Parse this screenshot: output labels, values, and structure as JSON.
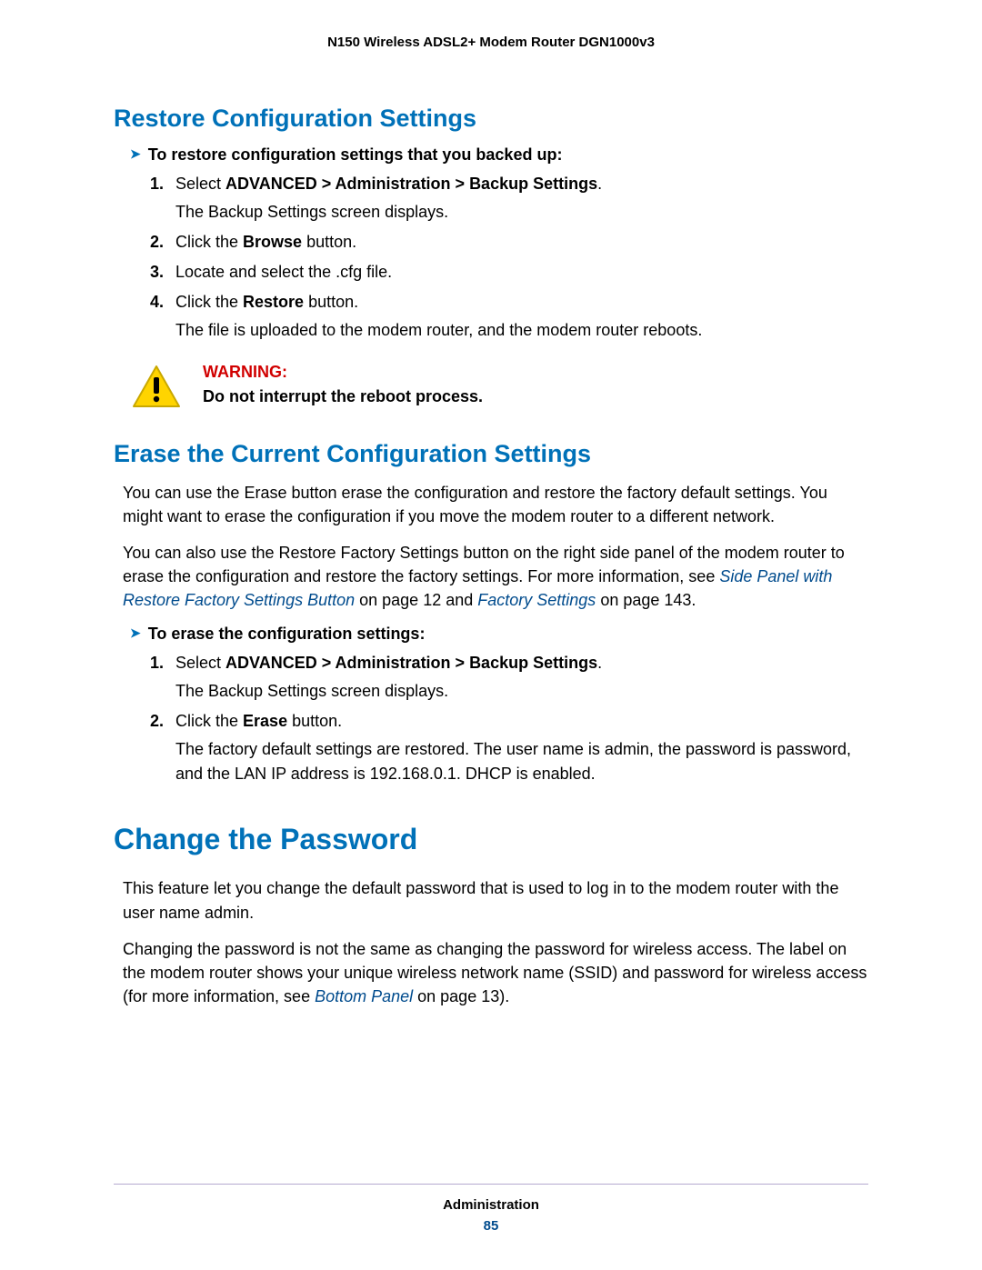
{
  "header": {
    "title": "N150 Wireless ADSL2+ Modem Router DGN1000v3"
  },
  "section1": {
    "title": "Restore Configuration Settings",
    "task": "To restore configuration settings that you backed up:",
    "step1_num": "1.",
    "step1_prefix": "Select ",
    "step1_bold": "ADVANCED > Administration > Backup Settings",
    "step1_suffix": ".",
    "step1_sub": "The Backup Settings screen displays.",
    "step2_num": "2.",
    "step2_a": "Click the ",
    "step2_b": "Browse",
    "step2_c": " button.",
    "step3_num": "3.",
    "step3": "Locate and select the .cfg file.",
    "step4_num": "4.",
    "step4_a": "Click the ",
    "step4_b": "Restore",
    "step4_c": " button.",
    "step4_sub": "The file is uploaded to the modem router, and the modem router reboots."
  },
  "warning": {
    "label": "WARNING:",
    "body": "Do not interrupt the reboot process."
  },
  "section2": {
    "title": "Erase the Current Configuration Settings",
    "para1": "You can use the Erase button erase the configuration and restore the factory default settings. You might want to erase the configuration if you move the modem router to a different network.",
    "para2_a": "You can also use the Restore Factory Settings button on the right side panel of the modem router to erase the configuration and restore the factory settings. For more information, see ",
    "para2_link1": "Side Panel with Restore Factory Settings Button",
    "para2_b": " on page 12 and ",
    "para2_link2": "Factory Settings",
    "para2_c": " on page 143.",
    "task": "To erase the configuration settings:",
    "step1_num": "1.",
    "step1_prefix": "Select ",
    "step1_bold": "ADVANCED > Administration > Backup Settings",
    "step1_suffix": ".",
    "step1_sub": "The Backup Settings screen displays.",
    "step2_num": "2.",
    "step2_a": "Click the ",
    "step2_b": "Erase",
    "step2_c": " button.",
    "step2_sub": "The factory default settings are restored. The user name is admin, the password is password, and the LAN IP address is 192.168.0.1. DHCP is enabled."
  },
  "section3": {
    "title": "Change the Password",
    "para1": "This feature let you change the default password that is used to log in to the modem router with the user name admin.",
    "para2_a": "Changing the password is not the same as changing the password for wireless access. The label on the modem router shows your unique wireless network name (SSID) and password for wireless access (for more information, see ",
    "para2_link": "Bottom Panel",
    "para2_b": " on page 13)."
  },
  "footer": {
    "label": "Administration",
    "page": "85"
  }
}
